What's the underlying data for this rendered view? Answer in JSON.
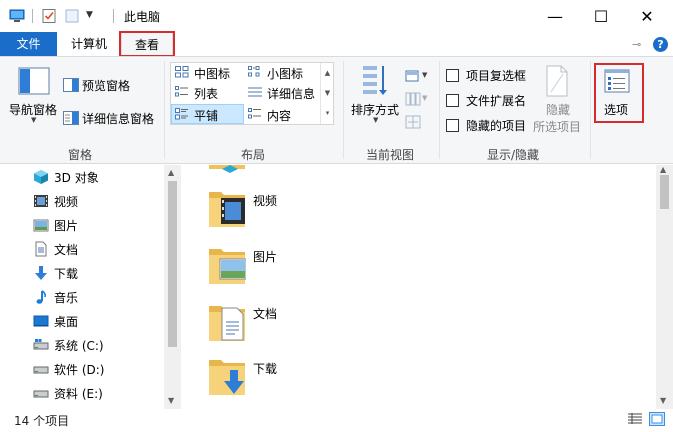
{
  "window": {
    "title": "此电脑",
    "minimize_glyph": "—",
    "maximize_glyph": "☐",
    "close_glyph": "✕"
  },
  "tabs": {
    "file": "文件",
    "computer": "计算机",
    "view": "查看",
    "active": "view",
    "highlight_color": "#d82b2b",
    "file_tab_color": "#1a6ec9"
  },
  "help": "?",
  "ribbon": {
    "panes": {
      "label": "窗格",
      "nav_pane": "导航窗格",
      "preview_pane": "预览窗格",
      "details_pane": "详细信息窗格"
    },
    "layout": {
      "label": "布局",
      "items": [
        "中图标",
        "小图标",
        "列表",
        "详细信息",
        "平铺",
        "内容"
      ],
      "selected": "平铺"
    },
    "current_view": {
      "label": "当前视图",
      "sort_by": "排序方式"
    },
    "show_hide": {
      "label": "显示/隐藏",
      "item_checkboxes": "项目复选框",
      "file_extensions": "文件扩展名",
      "hidden_items": "隐藏的项目",
      "hide_line1": "隐藏",
      "hide_line2": "所选项目"
    },
    "options": "选项"
  },
  "nav_items": [
    {
      "label": "3D 对象",
      "icon": "3d-objects-icon"
    },
    {
      "label": "视频",
      "icon": "videos-icon"
    },
    {
      "label": "图片",
      "icon": "pictures-icon"
    },
    {
      "label": "文档",
      "icon": "documents-icon"
    },
    {
      "label": "下载",
      "icon": "downloads-icon"
    },
    {
      "label": "音乐",
      "icon": "music-icon"
    },
    {
      "label": "桌面",
      "icon": "desktop-icon"
    },
    {
      "label": "系统 (C:)",
      "icon": "drive-icon"
    },
    {
      "label": "软件 (D:)",
      "icon": "drive-icon"
    },
    {
      "label": "资料 (E:)",
      "icon": "drive-icon"
    }
  ],
  "folders": [
    {
      "label": "视频",
      "icon": "videos-folder-icon"
    },
    {
      "label": "图片",
      "icon": "pictures-folder-icon"
    },
    {
      "label": "文档",
      "icon": "documents-folder-icon"
    },
    {
      "label": "下载",
      "icon": "downloads-folder-icon"
    }
  ],
  "status": {
    "item_count": "14 个项目"
  }
}
